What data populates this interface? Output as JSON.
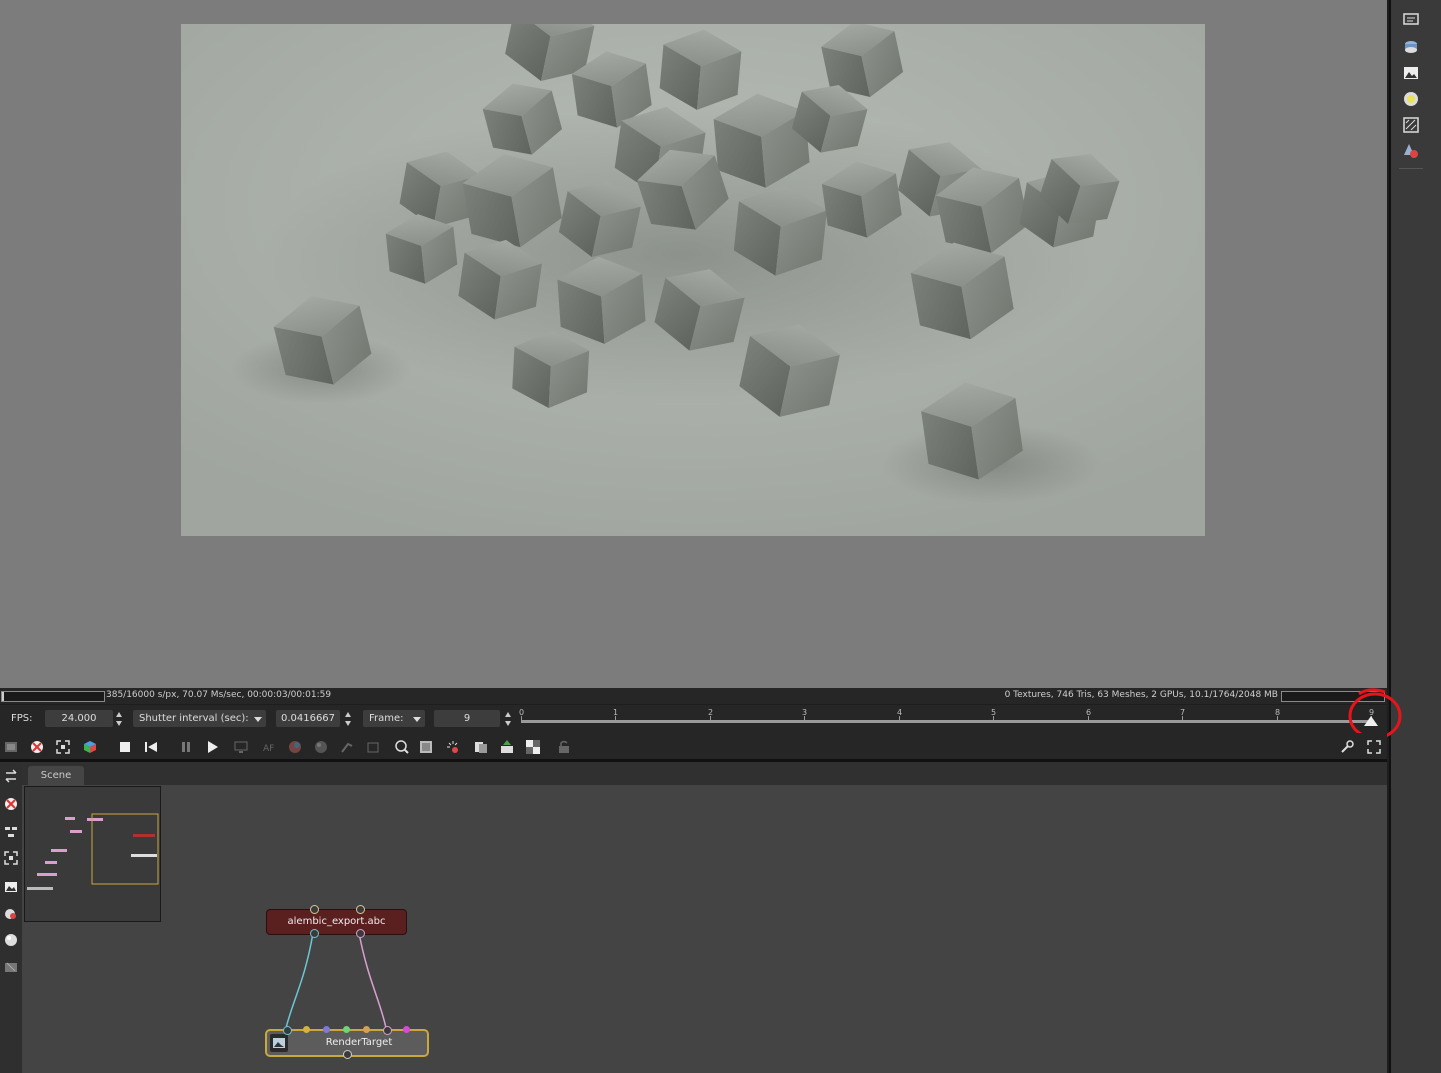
{
  "status": {
    "left_text": "385/16000 s/px, 70.07 Ms/sec, 00:00:03/00:01:59",
    "right_text": "0 Textures, 746 Tris, 63 Meshes, 2 GPUs, 10.1/1764/2048 MB",
    "left_progress": 0.02,
    "right_progress": 0.0
  },
  "timebar": {
    "fps_label": "FPS:",
    "fps_value": "24.000",
    "shutter_label": "Shutter interval (sec):",
    "shutter_value": "0.0416667",
    "frame_label": "Frame:",
    "frame_value": "9",
    "ticks": [
      "0",
      "1",
      "2",
      "3",
      "4",
      "5",
      "6",
      "7",
      "8",
      "9"
    ]
  },
  "graph": {
    "tab_label": "Scene",
    "node_abc_label": "alembic_export.abc",
    "node_rt_label": "RenderTarget"
  },
  "colors": {
    "annotation": "#e8141c",
    "node_abc": "#5a1f1f",
    "node_rt_border": "#c9a83e",
    "wire_cyan": "#6cc7d4",
    "wire_pink": "#d9a0cf"
  },
  "icons": {
    "sidebar": [
      "render-settings-icon",
      "geometry-icon",
      "image-icon",
      "light-icon",
      "texture-icon",
      "material-icon"
    ],
    "toolbar": [
      "viewport-icon",
      "recenter-icon",
      "fit-icon",
      "color-cube-icon",
      "stop-icon",
      "rewind-icon",
      "pause-icon",
      "play-icon",
      "display-icon",
      "af-icon",
      "color-picker-icon",
      "sphere-icon",
      "focus-icon",
      "material-picker-icon",
      "zoom-icon",
      "region-icon",
      "clay-icon",
      "copy-icon",
      "export-icon",
      "checker-icon",
      "lock-icon",
      "wrench-icon",
      "fullscreen-icon"
    ],
    "graph_left": [
      "swap-icon",
      "recenter-icon",
      "arrange-icon",
      "fit-graph-icon",
      "image-icon",
      "material-icon",
      "sphere-icon",
      "render-icon"
    ]
  }
}
